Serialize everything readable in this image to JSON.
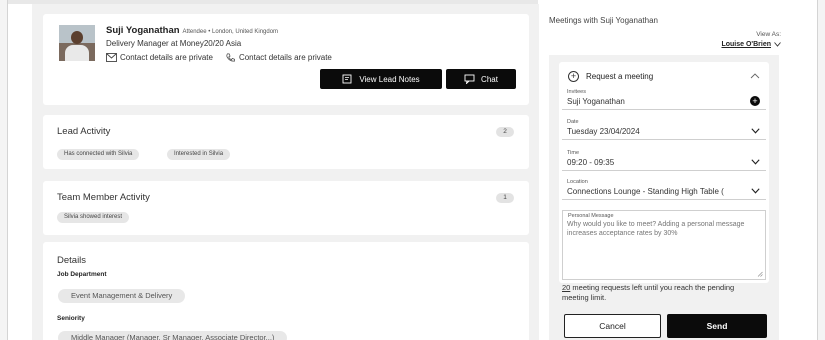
{
  "profile": {
    "name": "Suji Yoganathan",
    "meta": "Attendee • London, United Kingdom",
    "role": "Delivery Manager at Money20/20 Asia",
    "contact_email": "Contact details are private",
    "contact_phone": "Contact details are private",
    "view_notes_label": "View Lead Notes",
    "chat_label": "Chat"
  },
  "lead_activity": {
    "title": "Lead Activity",
    "count": "2",
    "chips": [
      "Has connected with Silvia",
      "Interested in Silvia"
    ]
  },
  "team_activity": {
    "title": "Team Member Activity",
    "count": "1",
    "chips": [
      "Silvia showed interest"
    ]
  },
  "details": {
    "title": "Details",
    "job_department_label": "Job Department",
    "job_department_value": "Event Management & Delivery",
    "seniority_label": "Seniority",
    "seniority_value": "Middle Manager (Manager, Sr Manager, Associate Director...)"
  },
  "meetings": {
    "title": "Meetings with Suji Yoganathan",
    "view_as_label": "View As:",
    "view_as_user": "Louise O'Brien",
    "request_label": "Request a meeting",
    "invitees_label": "Invitees",
    "invitees_value": "Suji Yoganathan",
    "date_label": "Date",
    "date_value": "Tuesday 23/04/2024",
    "time_label": "Time",
    "time_value": "09:20 - 09:35",
    "location_label": "Location",
    "location_value": "Connections Lounge - Standing High Table (",
    "message_label": "Personal Message",
    "message_placeholder": "Why would you like to meet? Adding a personal message increases acceptance rates by 30%",
    "remaining_count": "20",
    "remaining_text": " meeting requests left until you reach the pending meeting limit.",
    "cancel_label": "Cancel",
    "send_label": "Send"
  }
}
